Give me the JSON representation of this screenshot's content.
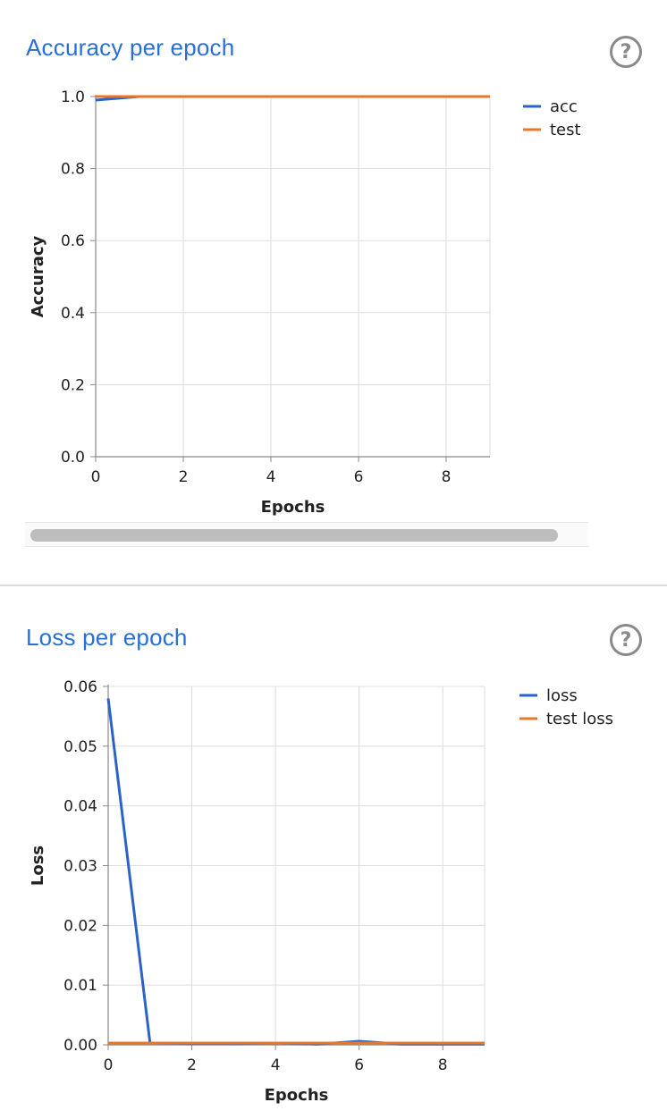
{
  "panels": {
    "accuracy": {
      "title": "Accuracy per epoch",
      "help_glyph": "?"
    },
    "loss": {
      "title": "Loss per epoch",
      "help_glyph": "?"
    }
  },
  "colors": {
    "series_1": "#2a64c5",
    "series_2": "#e8772e",
    "title": "#2a6fd6"
  },
  "chart_data": [
    {
      "type": "line",
      "title": "Accuracy per epoch",
      "xlabel": "Epochs",
      "ylabel": "Accuracy",
      "xlim": [
        0,
        9
      ],
      "ylim": [
        0,
        1.0
      ],
      "xticks": [
        0,
        2,
        4,
        6,
        8
      ],
      "yticks": [
        0.0,
        0.2,
        0.4,
        0.6,
        0.8,
        1.0
      ],
      "ytick_labels": [
        "0.0",
        "0.2",
        "0.4",
        "0.6",
        "0.8",
        "1.0"
      ],
      "grid": true,
      "legend": "right",
      "x": [
        0,
        1,
        2,
        3,
        4,
        5,
        6,
        7,
        8,
        9
      ],
      "series": [
        {
          "name": "acc",
          "values": [
            0.99,
            1.0,
            1.0,
            1.0,
            1.0,
            1.0,
            1.0,
            1.0,
            1.0,
            1.0
          ]
        },
        {
          "name": "test",
          "values": [
            1.0,
            1.0,
            1.0,
            1.0,
            1.0,
            1.0,
            1.0,
            1.0,
            1.0,
            1.0
          ]
        }
      ]
    },
    {
      "type": "line",
      "title": "Loss per epoch",
      "xlabel": "Epochs",
      "ylabel": "Loss",
      "xlim": [
        0,
        9
      ],
      "ylim": [
        0,
        0.06
      ],
      "xticks": [
        0,
        2,
        4,
        6,
        8
      ],
      "yticks": [
        0.0,
        0.01,
        0.02,
        0.03,
        0.04,
        0.05,
        0.06
      ],
      "ytick_labels": [
        "0.00",
        "0.01",
        "0.02",
        "0.03",
        "0.04",
        "0.05",
        "0.06"
      ],
      "grid": true,
      "legend": "right",
      "x": [
        0,
        1,
        2,
        3,
        4,
        5,
        6,
        7,
        8,
        9
      ],
      "series": [
        {
          "name": "loss",
          "values": [
            0.058,
            0.0003,
            0.0002,
            0.0002,
            0.0003,
            0.0001,
            0.0006,
            0.0001,
            0.0001,
            0.0001
          ]
        },
        {
          "name": "test loss",
          "values": [
            0.0003,
            0.0003,
            0.0003,
            0.0003,
            0.0003,
            0.0003,
            0.0003,
            0.0003,
            0.0003,
            0.0003
          ]
        }
      ]
    }
  ]
}
